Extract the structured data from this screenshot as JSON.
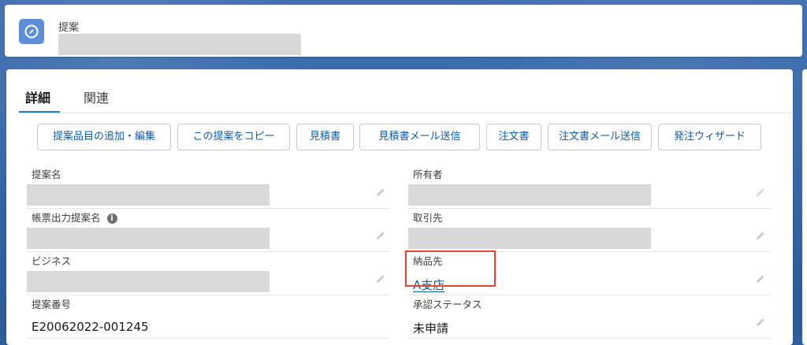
{
  "header": {
    "object_type": "提案",
    "title": ""
  },
  "tabs": [
    {
      "label": "詳細",
      "active": true
    },
    {
      "label": "関連",
      "active": false
    }
  ],
  "actions": [
    "提案品目の追加・編集",
    "この提案をコピー",
    "見積書",
    "見積書メール送信",
    "注文書",
    "注文書メール送信",
    "発注ウィザード"
  ],
  "fields": {
    "opportunity_name": {
      "label": "提案名",
      "value": ""
    },
    "owner": {
      "label": "所有者",
      "value": ""
    },
    "form_output_name": {
      "label": "帳票出力提案名",
      "value": ""
    },
    "account": {
      "label": "取引先",
      "value": ""
    },
    "business": {
      "label": "ビジネス",
      "value": ""
    },
    "delivery_to": {
      "label": "納品先",
      "value": "A支店"
    },
    "opportunity_number": {
      "label": "提案番号",
      "value": "E20062022-001245"
    },
    "approval_status": {
      "label": "承認ステータス",
      "value": "未申請"
    }
  },
  "icons": {
    "object": "compass-icon",
    "edit": "pencil-icon",
    "info": "info-icon"
  },
  "colors": {
    "brand": "#1b77d2",
    "link": "#0b5cab",
    "object_icon_bg": "#5d8ed8",
    "highlight": "#e0452f",
    "redacted": "#d9d9d9"
  }
}
